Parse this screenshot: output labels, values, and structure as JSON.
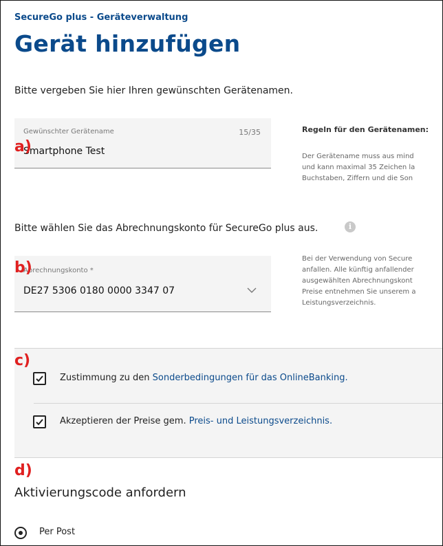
{
  "header": {
    "subtitle": "SecureGo plus - Geräteverwaltung",
    "title": "Gerät hinzufügen"
  },
  "device_name": {
    "prompt": "Bitte vergeben Sie hier Ihren gewünschten Gerätenamen.",
    "field_label": "Gewünschter Gerätename",
    "counter": "15/35",
    "value": "Smartphone Test",
    "rules_title": "Regeln für den Gerätenamen:",
    "rules_lines": [
      "Der Gerätename muss aus mind",
      "und kann maximal 35 Zeichen la",
      "Buchstaben, Ziffern und die Son"
    ]
  },
  "account": {
    "prompt": "Bitte wählen Sie das Abrechnungskonto für SecureGo plus aus.",
    "info_icon": "i",
    "field_label": "Abrechnungskonto *",
    "value": "DE27 5306 0180 0000 3347 07",
    "note_lines": [
      "Bei der Verwendung von Secure",
      "anfallen. Alle künftig anfallender",
      "ausgewählten Abrechnungskont",
      "Preise entnehmen Sie unserem a",
      "Leistungsverzeichnis."
    ]
  },
  "consent": {
    "item1_prefix": "Zustimmung zu den ",
    "item1_link": "Sonderbedingungen für das OnlineBanking.",
    "item2_prefix": "Akzeptieren der Preise gem. ",
    "item2_link": "Preis- und Leistungsverzeichnis."
  },
  "activation": {
    "heading": "Aktivierungscode anfordern",
    "option_post": "Per Post"
  },
  "markers": {
    "a": "a)",
    "b": "b)",
    "c": "c)",
    "d": "d)"
  },
  "colors": {
    "brand": "#0b4a8b",
    "marker": "#e02020",
    "field_bg": "#f4f4f4"
  }
}
